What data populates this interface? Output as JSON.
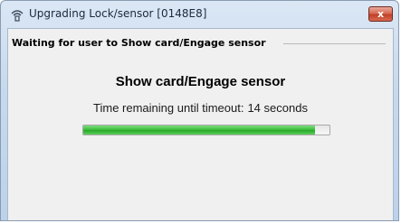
{
  "window": {
    "title": "Upgrading Lock/sensor [0148E8]",
    "close_label": "x"
  },
  "group": {
    "label": "Waiting for user to Show card/Engage sensor"
  },
  "main": {
    "heading": "Show card/Engage sensor",
    "timeout_label": "Time remaining until timeout:",
    "timeout_value": "14 seconds",
    "progress_fraction": 0.94
  },
  "colors": {
    "progress": "#3fbf3f",
    "close_button": "#c8462f"
  },
  "icons": {
    "title": "wireless-sensor-icon",
    "close": "close-icon"
  }
}
